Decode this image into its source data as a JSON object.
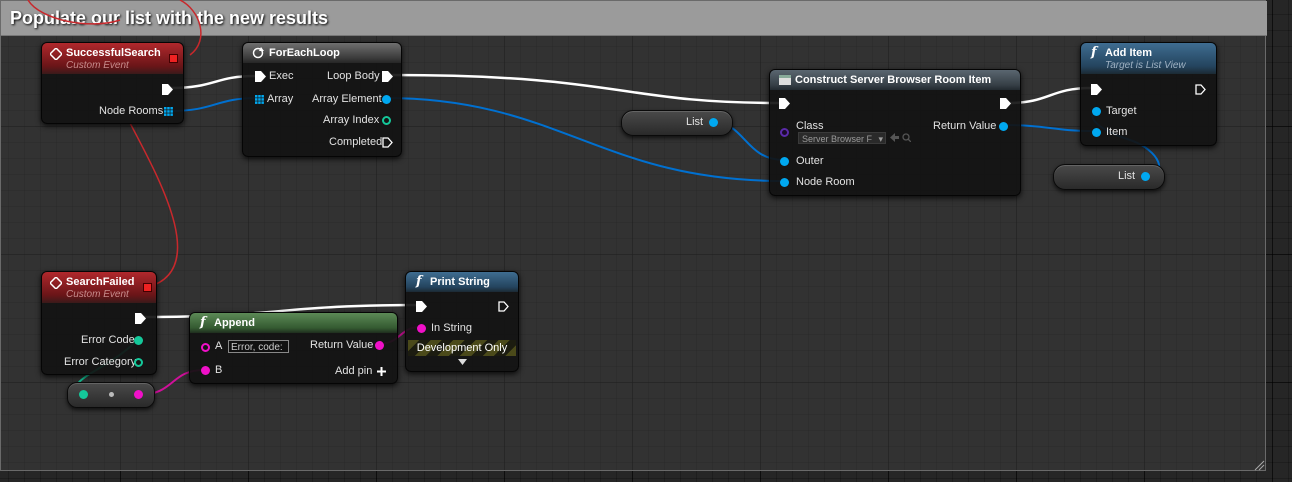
{
  "comment": {
    "title": "Populate our list with the new results"
  },
  "nodes": {
    "successful_search": {
      "title": "SuccessfulSearch",
      "subtitle": "Custom Event",
      "out_pin": "Node Rooms"
    },
    "foreach": {
      "title": "ForEachLoop",
      "exec_in": "Exec",
      "array_in": "Array",
      "loop_body": "Loop Body",
      "array_element": "Array Element",
      "array_index": "Array Index",
      "completed": "Completed"
    },
    "construct": {
      "title": "Construct Server Browser Room Item",
      "class_label": "Class",
      "class_value": "Server Browser F",
      "outer": "Outer",
      "node_room": "Node Room",
      "return_value": "Return Value"
    },
    "add_item": {
      "title": "Add Item",
      "subtitle": "Target is List View",
      "target": "Target",
      "item": "Item"
    },
    "list_var_1": {
      "label": "List"
    },
    "list_var_2": {
      "label": "List"
    },
    "search_failed": {
      "title": "SearchFailed",
      "subtitle": "Custom Event",
      "error_code": "Error Code",
      "error_category": "Error Category"
    },
    "append": {
      "title": "Append",
      "a_label": "A",
      "a_value": "Error, code:",
      "b_label": "B",
      "return_value": "Return Value",
      "add_pin": "Add pin"
    },
    "print_string": {
      "title": "Print String",
      "in_string": "In String",
      "dev_only": "Development Only"
    }
  },
  "colors": {
    "exec_wire": "#ffffff",
    "object_wire": "#0070d0",
    "string_wire": "#d0109a",
    "int_wire": "#14c89a",
    "delegate_wire": "#c8282c"
  }
}
